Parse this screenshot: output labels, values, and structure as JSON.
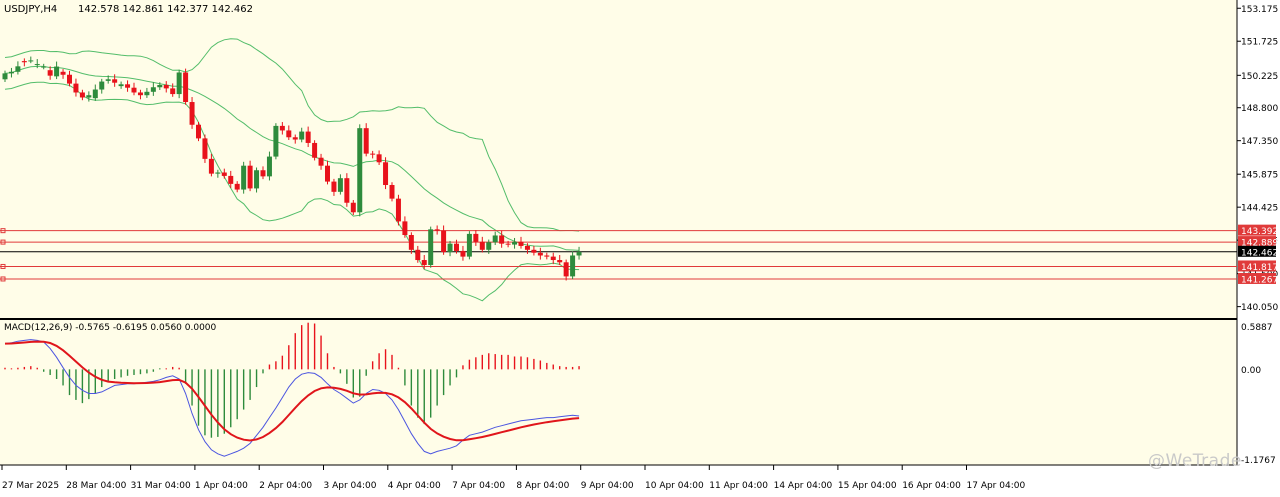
{
  "header": {
    "symbol": "USDJPY,H4",
    "ohlc": "142.578 142.861 142.377 142.462"
  },
  "macd": {
    "label": "MACD(12,26,9) -0.5765 -0.6195 0.0560 0.0000",
    "axis_labels": [
      "0.5887",
      "0.00",
      "-1.1767"
    ]
  },
  "watermark": "@WeTrade",
  "colors": {
    "background": "#fffde8",
    "bull": "#2e8b3c",
    "bear": "#e8121b",
    "band": "#53bd6a",
    "hline": "#e03a3a",
    "macd_main": "#4b55e0",
    "macd_signal": "#e0151b"
  },
  "chart_data": [
    {
      "type": "candlestick",
      "title": "USDJPY,H4",
      "y_ticks": [
        "153.175",
        "151.725",
        "150.225",
        "148.800",
        "147.350",
        "145.875",
        "144.425",
        "142.975",
        "141.500",
        "140.050"
      ],
      "y_tick_values": [
        153.175,
        151.725,
        150.225,
        148.8,
        147.35,
        145.875,
        144.425,
        142.975,
        141.5,
        140.05
      ],
      "ylim": [
        139.55,
        153.45
      ],
      "x_labels": [
        "27 Mar 2025",
        "28 Mar 04:00",
        "31 Mar 04:00",
        "1 Apr 04:00",
        "2 Apr 04:00",
        "3 Apr 04:00",
        "4 Apr 04:00",
        "7 Apr 04:00",
        "8 Apr 04:00",
        "9 Apr 04:00",
        "10 Apr 04:00",
        "11 Apr 04:00",
        "14 Apr 04:00",
        "15 Apr 04:00",
        "16 Apr 04:00",
        "17 Apr 04:00"
      ],
      "level_labels": [
        "143.392",
        "142.889",
        "142.462",
        "141.817",
        "141.267"
      ],
      "levels": [
        143.392,
        142.889,
        141.817,
        141.267
      ],
      "current_price": 142.462,
      "grid": false,
      "candles_close": [
        150.31,
        150.38,
        150.62,
        150.8,
        150.88,
        150.72,
        150.61,
        150.21,
        150.61,
        150.25,
        149.86,
        149.47,
        149.25,
        149.35,
        149.6,
        149.95,
        150.05,
        149.9,
        149.83,
        149.68,
        149.47,
        149.35,
        149.5,
        149.7,
        149.8,
        149.65,
        149.4,
        150.35,
        149.05,
        148.05,
        147.45,
        146.55,
        145.9,
        145.95,
        145.8,
        145.45,
        145.2,
        146.25,
        145.25,
        146.05,
        145.78,
        146.65,
        148.0,
        147.8,
        147.5,
        147.4,
        147.75,
        147.25,
        146.6,
        146.25,
        145.55,
        145.1,
        145.7,
        144.62,
        144.2,
        147.9,
        146.78,
        146.75,
        146.4,
        145.4,
        144.8,
        143.8,
        143.2,
        142.55,
        142.1,
        141.88,
        143.45,
        143.4,
        142.45,
        142.82,
        142.5,
        142.25,
        143.25,
        142.9,
        142.55,
        142.88,
        143.18,
        142.82,
        142.78,
        142.9,
        142.72,
        142.55,
        142.42,
        142.3,
        142.25,
        142.1,
        142.0,
        141.38,
        142.3,
        142.46
      ],
      "candles_open": [
        150.05,
        150.31,
        150.38,
        150.85,
        150.88,
        150.72,
        150.61,
        150.45,
        150.18,
        150.38,
        150.25,
        149.86,
        149.47,
        149.25,
        149.22,
        149.6,
        149.98,
        150.05,
        149.75,
        149.83,
        149.68,
        149.47,
        149.35,
        149.5,
        149.7,
        149.8,
        149.65,
        149.4,
        150.35,
        149.05,
        148.05,
        147.45,
        146.55,
        145.9,
        145.95,
        145.8,
        145.45,
        145.2,
        146.25,
        145.25,
        146.05,
        145.78,
        146.65,
        148.0,
        147.8,
        147.5,
        147.4,
        147.75,
        147.25,
        146.6,
        146.25,
        145.55,
        145.1,
        145.7,
        144.62,
        144.2,
        147.9,
        146.78,
        146.75,
        146.4,
        145.4,
        144.8,
        143.8,
        143.2,
        142.55,
        142.1,
        141.88,
        143.45,
        143.4,
        142.45,
        142.82,
        142.5,
        142.25,
        143.25,
        142.9,
        142.55,
        142.88,
        143.18,
        142.82,
        142.78,
        142.9,
        142.72,
        142.55,
        142.42,
        142.3,
        142.25,
        142.1,
        142.0,
        141.38,
        142.3
      ]
    },
    {
      "type": "bar",
      "title": "MACD(12,26,9) -0.5765 -0.6195 0.0560 0.0000",
      "ylim": [
        -1.1767,
        0.5887
      ],
      "macd_histogram": [
        0.02,
        0.01,
        0.02,
        0.03,
        0.04,
        0.02,
        -0.03,
        -0.07,
        -0.12,
        -0.2,
        -0.32,
        -0.38,
        -0.42,
        -0.37,
        -0.3,
        -0.22,
        -0.15,
        -0.12,
        -0.1,
        -0.08,
        -0.07,
        -0.06,
        -0.05,
        -0.03,
        -0.01,
        0.01,
        0.03,
        0.02,
        -0.18,
        -0.45,
        -0.7,
        -0.82,
        -0.85,
        -0.84,
        -0.8,
        -0.72,
        -0.62,
        -0.5,
        -0.38,
        -0.22,
        -0.05,
        0.06,
        0.1,
        0.17,
        0.3,
        0.45,
        0.55,
        0.58,
        0.57,
        0.42,
        0.2,
        0.03,
        -0.05,
        -0.18,
        -0.35,
        -0.34,
        -0.08,
        0.1,
        0.2,
        0.25,
        0.18,
        0.02,
        -0.2,
        -0.45,
        -0.6,
        -0.68,
        -0.6,
        -0.45,
        -0.32,
        -0.2,
        -0.1,
        0.05,
        0.12,
        0.15,
        0.18,
        0.2,
        0.19,
        0.18,
        0.18,
        0.16,
        0.16,
        0.15,
        0.13,
        0.11,
        0.08,
        0.06,
        0.04,
        0.03,
        0.03,
        0.04
      ],
      "macd_main": [
        0.32,
        0.33,
        0.35,
        0.36,
        0.37,
        0.36,
        0.34,
        0.26,
        0.15,
        0.02,
        -0.1,
        -0.2,
        -0.26,
        -0.3,
        -0.3,
        -0.28,
        -0.24,
        -0.2,
        -0.19,
        -0.18,
        -0.18,
        -0.17,
        -0.16,
        -0.15,
        -0.13,
        -0.1,
        -0.08,
        -0.12,
        -0.3,
        -0.55,
        -0.75,
        -0.9,
        -1.0,
        -1.05,
        -1.08,
        -1.05,
        -1.02,
        -0.98,
        -0.92,
        -0.82,
        -0.72,
        -0.6,
        -0.48,
        -0.35,
        -0.22,
        -0.12,
        -0.06,
        -0.04,
        -0.05,
        -0.1,
        -0.18,
        -0.25,
        -0.3,
        -0.36,
        -0.42,
        -0.38,
        -0.3,
        -0.25,
        -0.26,
        -0.3,
        -0.38,
        -0.5,
        -0.65,
        -0.8,
        -0.92,
        -1.02,
        -1.05,
        -1.02,
        -1.0,
        -0.98,
        -0.95,
        -0.88,
        -0.82,
        -0.8,
        -0.78,
        -0.75,
        -0.72,
        -0.7,
        -0.68,
        -0.66,
        -0.64,
        -0.63,
        -0.62,
        -0.61,
        -0.6,
        -0.6,
        -0.59,
        -0.58,
        -0.57,
        -0.58
      ]
    }
  ]
}
